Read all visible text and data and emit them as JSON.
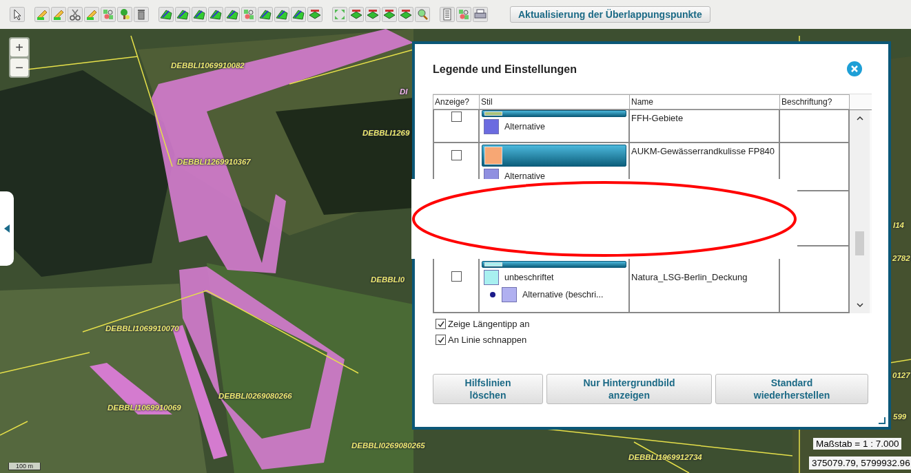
{
  "toolbar": {
    "update_button": "Aktualisierung der Überlappungspunkte"
  },
  "map": {
    "zoom_in": "+",
    "zoom_out": "−",
    "scale_bar": "100 m",
    "scale": "Maßstab = 1 : 7.000",
    "coordinates": "375079.79, 5799932.96",
    "labels": [
      "DEBBLI1069910082",
      "DI",
      "DEBBLI1269910367",
      "DEBBLI1269",
      "DEBBLI0",
      "DEBBLI1069910070",
      "DEBBLI0269080266",
      "DEBBLI1069910069",
      "DEBBLI0269080265",
      "DEBBLI1969912734",
      "I14",
      "2782",
      "0127",
      "599"
    ]
  },
  "dialog": {
    "title": "Legende und Einstellungen",
    "columns": [
      "Anzeige?",
      "Stil",
      "Name",
      "Beschriftung?"
    ],
    "rows": [
      {
        "shown": false,
        "name": "FFH-Gebiete",
        "color": "#a8c47a",
        "styles": [
          {
            "kind": "alternative",
            "label": "Alternative",
            "color": "#6b6be0"
          }
        ]
      },
      {
        "shown": false,
        "name": "AUKM-Gewässerrandkulisse FP840",
        "color": "#f7a774",
        "styles": [
          {
            "kind": "alternative",
            "label": "Alternative",
            "color": "#8f8fe0"
          }
        ]
      },
      {
        "shown": false,
        "name": "Natura_LSG-Berlin_Deckung",
        "color": "#a8f0f0",
        "styles": [
          {
            "kind": "plain",
            "label": "unbeschriftet",
            "color": "#a8f0f0"
          },
          {
            "kind": "labelled",
            "label": "Alternative (beschri...",
            "color": "#b0b0f0"
          }
        ]
      }
    ],
    "options": [
      {
        "label": "Zeige Längentipp an",
        "checked": true
      },
      {
        "label": "An Linie schnappen",
        "checked": true
      }
    ],
    "buttons": [
      "Hilfslinien\nlöschen",
      "Nur Hintergrundbild\nanzeigen",
      "Standard\nwiederherstellen"
    ]
  }
}
